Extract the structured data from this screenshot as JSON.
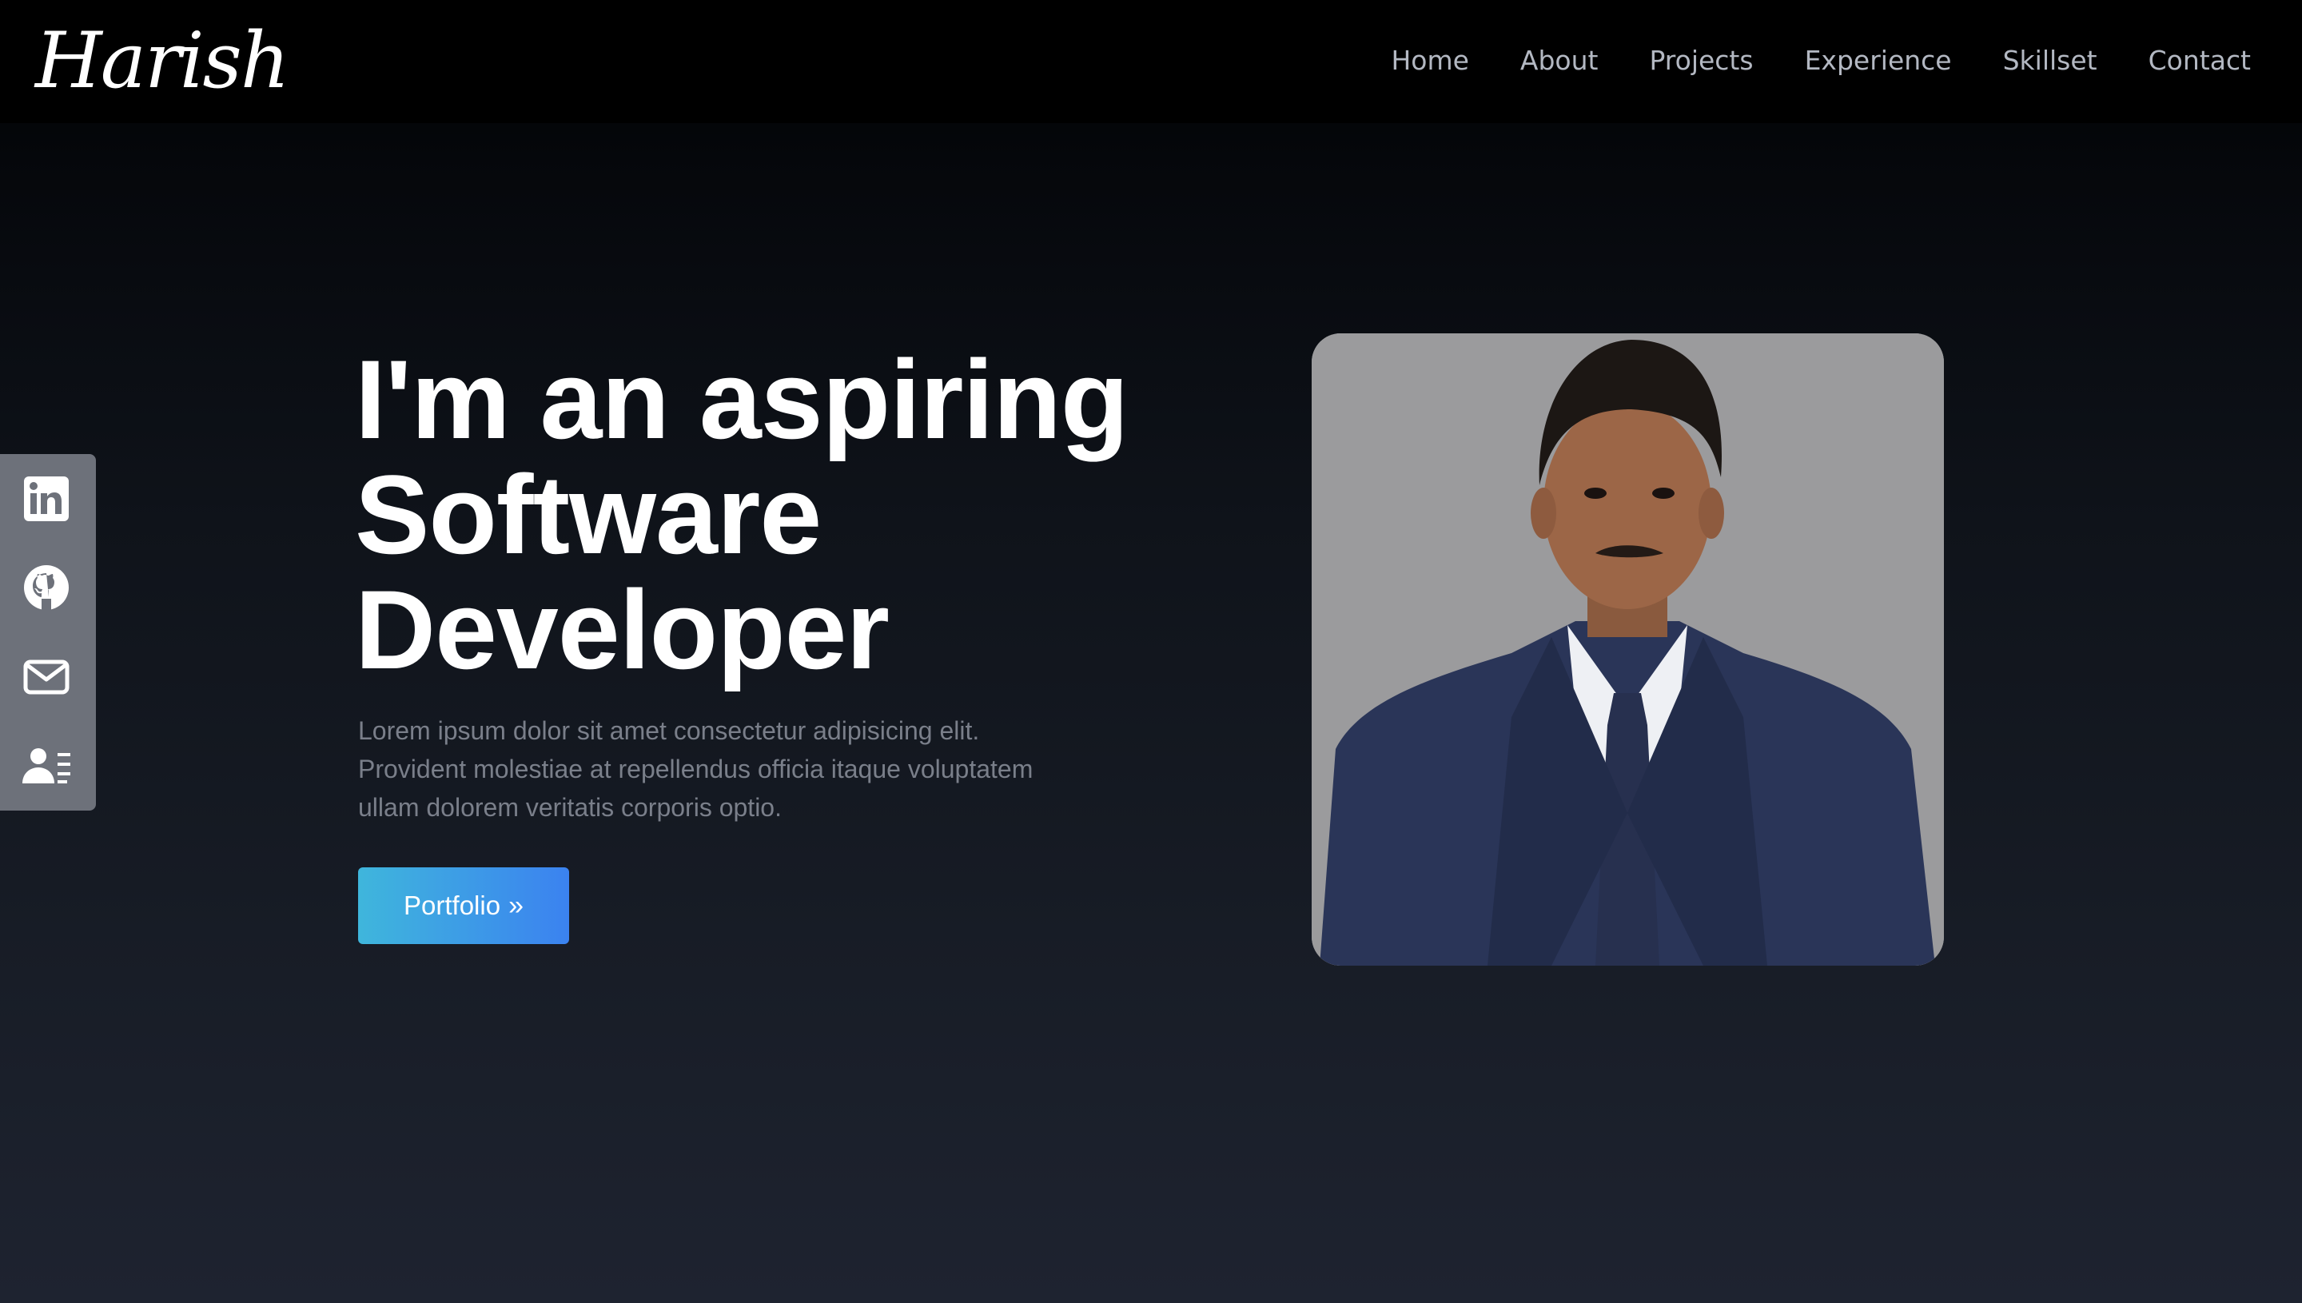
{
  "nav": {
    "logo": "Harish",
    "links": [
      "Home",
      "About",
      "Projects",
      "Experience",
      "Skillset",
      "Contact"
    ]
  },
  "social": {
    "items": [
      {
        "icon": "linkedin-icon"
      },
      {
        "icon": "github-icon"
      },
      {
        "icon": "mail-icon"
      },
      {
        "icon": "contact-card-icon"
      }
    ]
  },
  "hero": {
    "title_lines": [
      "I'm an aspiring",
      "Software",
      "Developer"
    ],
    "description_lines": [
      "Lorem ipsum dolor sit amet consectetur adipisicing elit.",
      "Provident molestiae at repellendus officia itaque voluptatem",
      "ullam dolorem veritatis corporis optio."
    ],
    "button_label": "Portfolio",
    "button_icon": "double-chevron-right-icon"
  },
  "profile": {
    "image": "profile-photo"
  },
  "colors": {
    "background_top": "#000000",
    "background_bottom": "#1e2330",
    "nav_text": "#b3b8c2",
    "sidebar": "#6d717a",
    "button_gradient_start": "#3fb6dc",
    "button_gradient_end": "#3b82f0",
    "description_text": "#7a7f8a"
  }
}
